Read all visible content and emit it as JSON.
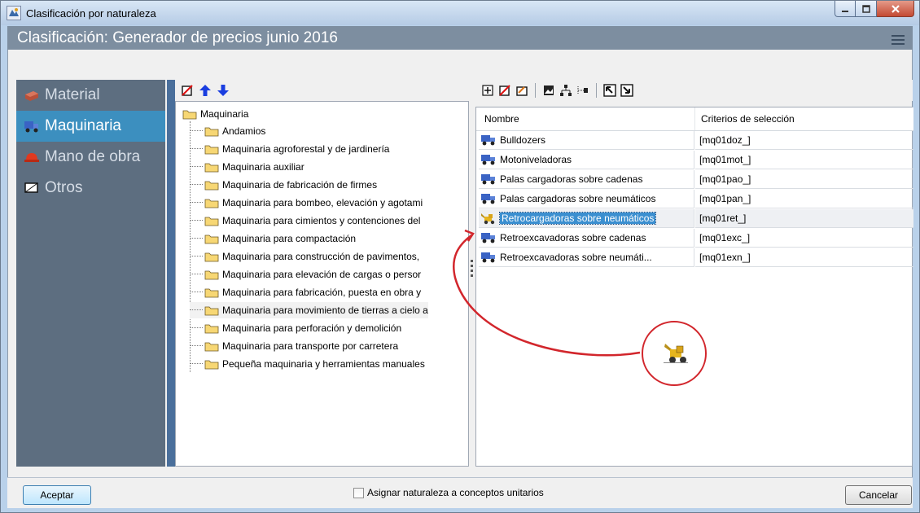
{
  "window": {
    "title": "Clasificación por naturaleza",
    "app_icon": "classification-app-icon",
    "caption_buttons": [
      "minimize",
      "maximize",
      "close"
    ]
  },
  "header": {
    "title": "Clasificación: Generador de precios junio 2016",
    "menu_icon": "hamburger-menu-icon"
  },
  "nav": {
    "items": [
      {
        "label": "Material",
        "icon": "brick-icon",
        "selected": false
      },
      {
        "label": "Maquinaria",
        "icon": "truck-icon",
        "selected": true
      },
      {
        "label": "Mano de obra",
        "icon": "hard-hat-icon",
        "selected": false
      },
      {
        "label": "Otros",
        "icon": "box-icon",
        "selected": false
      }
    ]
  },
  "tree": {
    "toolbar": [
      "delete-icon",
      "move-up-icon",
      "move-down-icon"
    ],
    "root": "Maquinaria",
    "items": [
      "Andamios",
      "Maquinaria agroforestal y de jardinería",
      "Maquinaria auxiliar",
      "Maquinaria de fabricación de firmes",
      "Maquinaria para bombeo, elevación y agotami",
      "Maquinaria para cimientos y contenciones del",
      "Maquinaria para compactación",
      "Maquinaria para construcción de pavimentos,",
      "Maquinaria para elevación de cargas o persor",
      "Maquinaria para fabricación, puesta en obra y",
      "Maquinaria para movimiento de tierras a cielo a",
      "Maquinaria para perforación y demolición",
      "Maquinaria para transporte por carretera",
      "Pequeña maquinaria y herramientas manuales"
    ],
    "highlighted_index": 10
  },
  "grid": {
    "toolbar": [
      "add-icon",
      "delete-icon",
      "edit-icon",
      "image-icon",
      "tree-icon",
      "connector-icon",
      "expand-icon",
      "collapse-icon"
    ],
    "columns": [
      "Nombre",
      "Criterios de selección"
    ],
    "rows": [
      {
        "name": "Bulldozers",
        "criteria": "[mq01doz_]",
        "icon": "truck-icon"
      },
      {
        "name": "Motoniveladoras",
        "criteria": "[mq01mot_]",
        "icon": "truck-icon"
      },
      {
        "name": "Palas cargadoras sobre cadenas",
        "criteria": "[mq01pao_]",
        "icon": "truck-icon"
      },
      {
        "name": "Palas cargadoras sobre neumáticos",
        "criteria": "[mq01pan_]",
        "icon": "truck-icon"
      },
      {
        "name": "Retrocargadoras sobre neumáticos",
        "criteria": "[mq01ret_]",
        "icon": "backhoe-icon"
      },
      {
        "name": "Retroexcavadoras sobre cadenas",
        "criteria": "[mq01exc_]",
        "icon": "truck-icon"
      },
      {
        "name": "Retroexcavadoras sobre neumáti...",
        "criteria": "[mq01exn_]",
        "icon": "truck-icon"
      }
    ],
    "selected_index": 4
  },
  "footer": {
    "accept_label": "Aceptar",
    "checkbox_label": "Asignar naturaleza a conceptos unitarios",
    "checkbox_checked": false,
    "cancel_label": "Cancelar"
  },
  "colors": {
    "header_band": "#7d8ea0",
    "nav_bg": "#5d6e80",
    "nav_selected": "#3c8fbf",
    "tree_stripe": "#4a6f9b",
    "selection": "#3b8fd0",
    "annotation_red": "#d2262c"
  }
}
